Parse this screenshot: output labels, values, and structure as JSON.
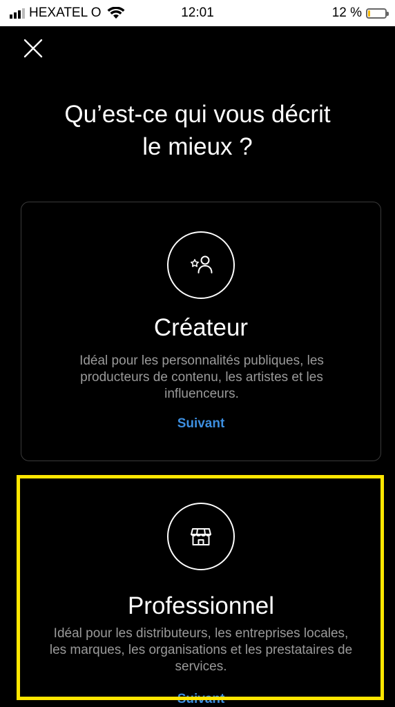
{
  "status_bar": {
    "carrier": "HEXATEL O",
    "time": "12:01",
    "battery": "12 %",
    "battery_level": 0.12
  },
  "header": {
    "close_icon": "close-icon",
    "title_line1": "Qu’est-ce qui vous décrit",
    "title_line2": "le mieux ?"
  },
  "options": [
    {
      "icon": "creator-star-person-icon",
      "title": "Créateur",
      "description": "Idéal pour les personnalités publiques, les producteurs de contenu, les artistes et les influenceurs.",
      "action": "Suivant"
    },
    {
      "icon": "storefront-icon",
      "title": "Professionnel",
      "description": "Idéal pour les distributeurs, les entreprises locales, les marques, les organisations et les prestataires de services.",
      "action": "Suivant"
    }
  ],
  "colors": {
    "background": "#000000",
    "link": "#3d8fe0",
    "highlight": "#ffe600",
    "description": "#9a9a9a",
    "battery_fill": "#f5b800"
  }
}
